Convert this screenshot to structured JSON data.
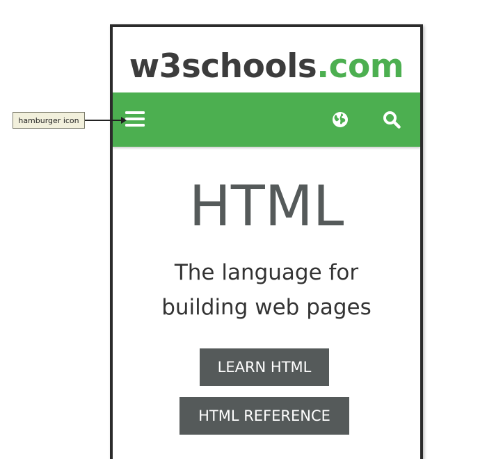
{
  "header": {
    "logo_brand": "w3schools",
    "logo_tld": ".com"
  },
  "navbar": {
    "menu_icon": "hamburger-icon",
    "globe_icon": "globe-icon",
    "search_icon": "search-icon",
    "background_color": "#4caf50"
  },
  "hero": {
    "title": "HTML",
    "subtitle_line1": "The language for",
    "subtitle_line2": "building web pages"
  },
  "buttons": {
    "learn_label": "LEARN HTML",
    "reference_label": "HTML REFERENCE",
    "background_color": "#555a5a"
  },
  "annotation": {
    "label": "hamburger icon"
  }
}
